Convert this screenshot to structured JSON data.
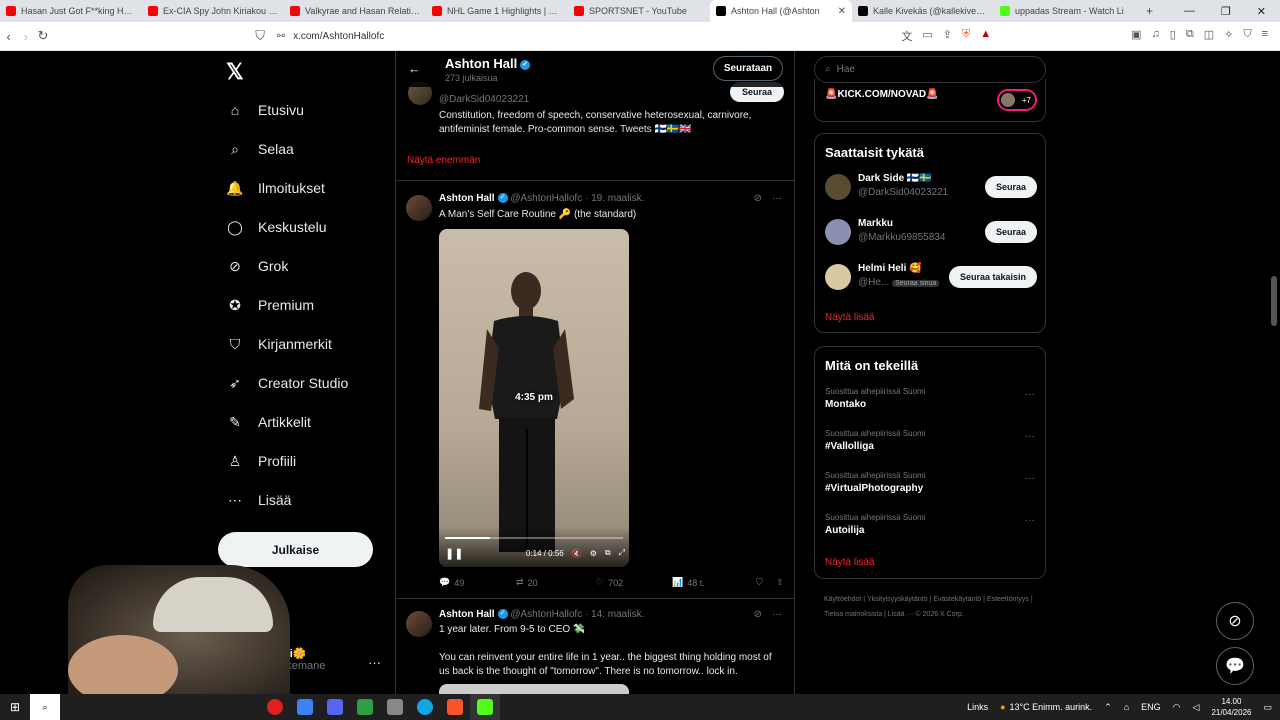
{
  "browser": {
    "tabs": [
      {
        "title": "Hasan Just Got F**king Humilia",
        "color": "#ff0000"
      },
      {
        "title": "Ex-CIA Spy John Kiriakou on br",
        "color": "#ff0000"
      },
      {
        "title": "Valkyrae and Hasan Relationsh",
        "color": "#ff0000"
      },
      {
        "title": "NHL Game 1 Highlights | Duck",
        "color": "#ff0000"
      },
      {
        "title": "SPORTSNET - YouTube",
        "color": "#ff0000"
      },
      {
        "title": "Ashton Hall (@Ashton",
        "color": "#000000",
        "active": true
      },
      {
        "title": "Kalle Kivekäs (@kallekivekas) /",
        "color": "#000000"
      },
      {
        "title": "uppadas Stream - Watch Li",
        "color": "#53fc18"
      }
    ],
    "url": "x.com/AshtonHallofc"
  },
  "nav": {
    "logo": "𝕏",
    "items": [
      {
        "label": "Etusivu",
        "icon": "home-icon"
      },
      {
        "label": "Selaa",
        "icon": "search-icon"
      },
      {
        "label": "Ilmoitukset",
        "icon": "bell-icon"
      },
      {
        "label": "Keskustelu",
        "icon": "chat-icon"
      },
      {
        "label": "Grok",
        "icon": "grok-icon"
      },
      {
        "label": "Premium",
        "icon": "verified-icon"
      },
      {
        "label": "Kirjanmerkit",
        "icon": "bookmark-icon"
      },
      {
        "label": "Creator Studio",
        "icon": "rocket-icon"
      },
      {
        "label": "Artikkelit",
        "icon": "article-icon"
      },
      {
        "label": "Profiili",
        "icon": "person-icon"
      },
      {
        "label": "Lisää",
        "icon": "more-icon"
      }
    ],
    "post_label": "Julkaise",
    "account": {
      "name": "mikedi🌼",
      "handle": "@mikkemane"
    }
  },
  "profile": {
    "name": "Ashton Hall",
    "post_count": "273 julkaisua",
    "following_label": "Seurataan"
  },
  "top_card": {
    "handle": "@DarkSid04023221",
    "follow_label": "Seuraa",
    "bio": "Constitution, freedom of speech, conservative heterosexual, carnivore, antifeminist female. Pro-common sense. Tweets 🇫🇮🇸🇪🇬🇧",
    "show_more": "Näytä enemmän"
  },
  "tweets": [
    {
      "name": "Ashton Hall",
      "handle": "@AshtonHallofc",
      "date": "19. maalisk.",
      "text": "A Man's Self Care Routine 🔑 (the standard)",
      "video_timestamp": "4:35 pm",
      "video_time": "0:14 / 0:56",
      "video_progress": 0.25,
      "replies": "49",
      "reposts": "20",
      "likes": "702",
      "views": "48 t."
    },
    {
      "name": "Ashton Hall",
      "handle": "@AshtonHallofc",
      "date": "14. maalisk.",
      "text": "1 year later. From 9-5 to CEO 💸",
      "text2": "You can reinvent your entire life in 1 year.. the biggest thing holding most of us back is the thought of \"tomorrow\". There is no tomorrow.. lock in."
    }
  ],
  "right": {
    "search_placeholder": "Hae",
    "kick_label": "🚨KICK.COM/NOVAD🚨",
    "kick_count": "+7",
    "suggest_title": "Saattaisit tykätä",
    "suggestions": [
      {
        "name": "Dark Side 🇫🇮🇸🇪",
        "handle": "@DarkSid04023221",
        "button": "Seuraa"
      },
      {
        "name": "Markku",
        "handle": "@Markku69855834",
        "button": "Seuraa"
      },
      {
        "name": "Helmi Heli 🥰",
        "handle": "@He...",
        "badge": "Seuraa sinua",
        "button": "Seuraa takaisin"
      }
    ],
    "show_more": "Näytä lisää",
    "trends_title": "Mitä on tekeillä",
    "trends": [
      {
        "category": "Suosittua aihepiirissä Suomi",
        "name": "Montako"
      },
      {
        "category": "Suosittua aihepiirissä Suomi",
        "name": "#Vallolliga"
      },
      {
        "category": "Suosittua aihepiirissä Suomi",
        "name": "#VirtualPhotography"
      },
      {
        "category": "Suosittua aihepiirissä Suomi",
        "name": "Autoilija"
      }
    ],
    "trends_more": "Näytä lisää",
    "footer": "Käyttöehdot | Yksityisyyskäytäntö | Evästekäytäntö | Esteettömyys | Tietoa mainoksista | Lisää ··· © 2026 X Corp."
  },
  "taskbar": {
    "links_label": "Links",
    "weather": "13°C  Enimm. aurink.",
    "lang": "ENG",
    "time": "14.00",
    "date": "21/04/2026"
  },
  "colors": {
    "accent": "#1d9bf0",
    "link_red": "#f4212e",
    "border": "#2f3336"
  }
}
